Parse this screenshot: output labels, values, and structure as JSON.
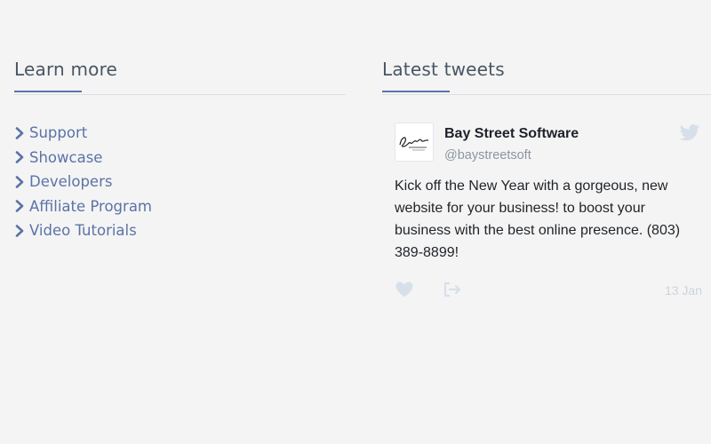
{
  "learn_more": {
    "title": "Learn more",
    "links": [
      {
        "label": "Support"
      },
      {
        "label": "Showcase"
      },
      {
        "label": "Developers"
      },
      {
        "label": "Affiliate Program"
      },
      {
        "label": "Video Tutorials"
      }
    ]
  },
  "latest_tweets": {
    "title": "Latest tweets",
    "tweet": {
      "author": "Bay Street Software",
      "handle": "@baystreetsoft",
      "avatar_icon": "bay-street-logo",
      "text": "Kick off the New Year with a gorgeous, new website for your business! to boost your business with the best online presence. (803) 389-8899!",
      "date": "13 Jan"
    }
  },
  "colors": {
    "background": "#f4f4f4",
    "link": "#5b73a6",
    "heading": "#4a5563",
    "accent_rule": "#5b73a6",
    "muted": "#cdd3da"
  },
  "icons": [
    "chevron-right-icon",
    "twitter-bird-icon",
    "heart-icon",
    "share-icon"
  ]
}
